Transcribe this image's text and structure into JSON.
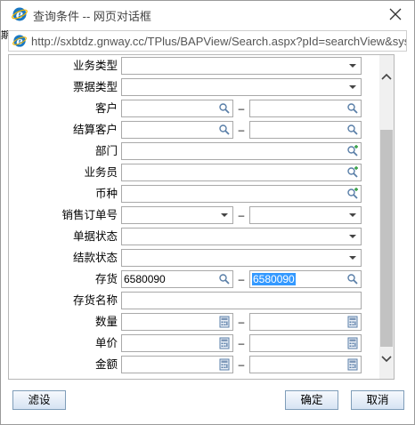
{
  "window": {
    "title": "查询条件 -- 网页对话框",
    "close_icon": "close-icon",
    "browser_icon": "ie-icon"
  },
  "background_fragment": "期",
  "address": {
    "host": "http://sxbtdz.gnway.cc",
    "path": "/TPlus/BAPView/Search.aspx?pId=searchView&sys"
  },
  "form": {
    "rows": [
      {
        "label": "业务类型",
        "kind": "select"
      },
      {
        "label": "票据类型",
        "kind": "select"
      },
      {
        "label": "客户",
        "kind": "range-search",
        "from": "",
        "to": ""
      },
      {
        "label": "结算客户",
        "kind": "range-search",
        "from": "",
        "to": ""
      },
      {
        "label": "部门",
        "kind": "ref"
      },
      {
        "label": "业务员",
        "kind": "ref"
      },
      {
        "label": "币种",
        "kind": "ref"
      },
      {
        "label": "销售订单号",
        "kind": "range-select",
        "from": "",
        "to": ""
      },
      {
        "label": "单据状态",
        "kind": "select"
      },
      {
        "label": "结款状态",
        "kind": "select"
      },
      {
        "label": "存货",
        "kind": "range-search",
        "from": "6580090",
        "to": "6580090"
      },
      {
        "label": "存货名称",
        "kind": "text"
      },
      {
        "label": "数量",
        "kind": "range-calc",
        "from": "",
        "to": ""
      },
      {
        "label": "单价",
        "kind": "range-calc",
        "from": "",
        "to": ""
      },
      {
        "label": "金额",
        "kind": "range-calc",
        "from": "",
        "to": ""
      }
    ],
    "range_separator": "–"
  },
  "buttons": {
    "filter": "滤设",
    "ok": "确定",
    "cancel": "取消"
  },
  "colors": {
    "selection": "#3399ff",
    "scrollbar_track": "#f0f0f0",
    "scrollbar_thumb": "#c2c2c2",
    "button_border": "#7f9db9"
  }
}
